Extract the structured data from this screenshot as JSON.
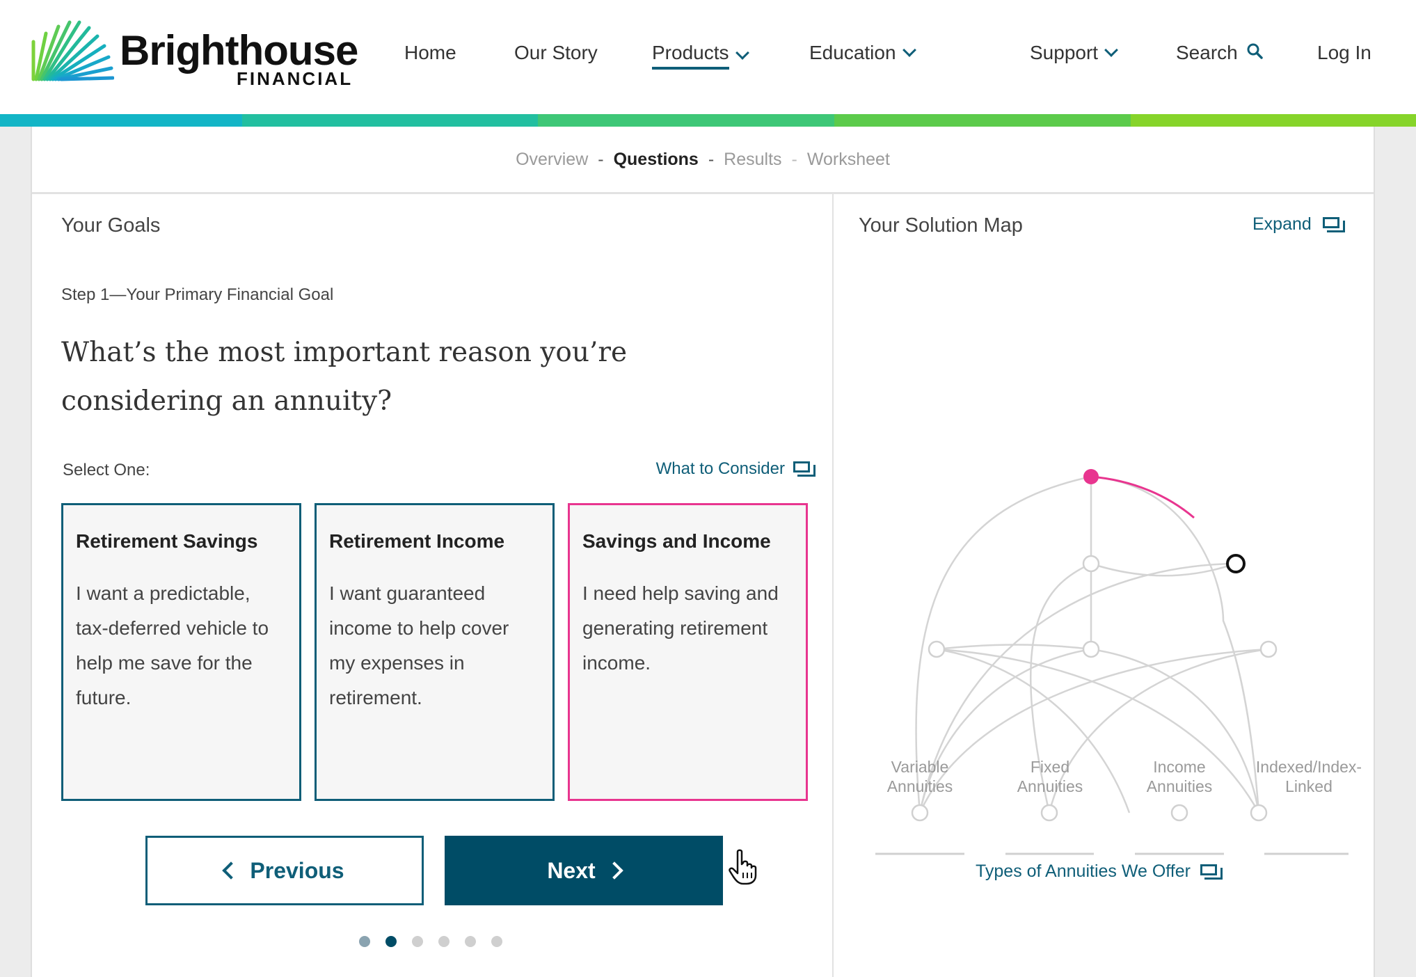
{
  "brand": {
    "name": "Brighthouse",
    "sub": "FINANCIAL"
  },
  "nav": {
    "home": "Home",
    "our_story": "Our Story",
    "products": "Products",
    "education": "Education",
    "support": "Support",
    "search": "Search",
    "login": "Log In"
  },
  "colors": {
    "accent": "#0f5e78",
    "button_dark": "#004c66",
    "selected": "#e8358f",
    "stripe": [
      "#13b5c6",
      "#22bfa0",
      "#3ec777",
      "#5ccb4b",
      "#86d42a"
    ]
  },
  "steps": {
    "overview": "Overview",
    "questions": "Questions",
    "results": "Results",
    "worksheet": "Worksheet",
    "sep": "-"
  },
  "goals": {
    "title": "Your Goals",
    "step_label": "Step 1—Your Primary Financial Goal",
    "question_line1": "What’s the most important reason you’re",
    "question_line2": "considering an annuity?",
    "select_one": "Select One:",
    "what_to_consider": "What to Consider",
    "options": [
      {
        "title": "Retirement Savings",
        "desc": "I want a predictable, tax-deferred vehicle to help me save for the future."
      },
      {
        "title": "Retirement Income",
        "desc": "I want guaranteed income to help cover my expenses in retirement."
      },
      {
        "title": "Savings and Income",
        "desc": "I need help saving and generating retirement income."
      }
    ],
    "selected_option": "Savings and Income",
    "previous": "Previous",
    "next": "Next",
    "progress": {
      "total": 6,
      "current": 2
    }
  },
  "solution_map": {
    "title": "Your Solution Map",
    "expand": "Expand",
    "categories": [
      {
        "line1": "Variable",
        "line2": "Annuities"
      },
      {
        "line1": "Fixed",
        "line2": "Annuities"
      },
      {
        "line1": "Income",
        "line2": "Annuities"
      },
      {
        "line1": "Indexed/Index-",
        "line2": "Linked"
      }
    ],
    "types_link": "Types of Annuities We Offer"
  }
}
